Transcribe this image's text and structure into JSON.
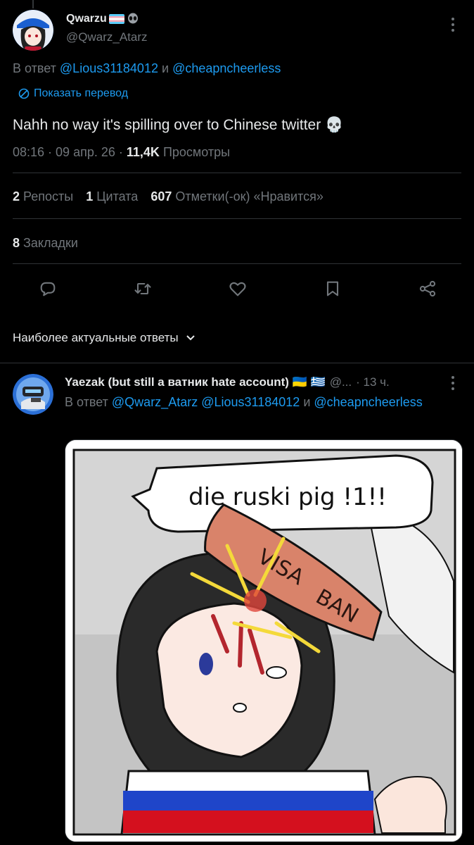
{
  "tweet": {
    "display_name": "Qwarzu",
    "handle": "@Qwarz_Atarz",
    "reply_prefix": "В ответ",
    "reply_mention_1": "@Lious31184012",
    "reply_and": "и",
    "reply_mention_2": "@cheapncheerless",
    "translate_label": "Показать перевод",
    "text": "Nahh no way it's spilling over to Chinese twitter 💀",
    "time": "08:16 · 09 апр. 26 ·",
    "views_count": "11,4K",
    "views_label": "Просмотры",
    "reposts_count": "2",
    "reposts_label": "Репосты",
    "quotes_count": "1",
    "quotes_label": "Цитата",
    "likes_count": "607",
    "likes_label": "Отметки(-ок) «Нравится»",
    "bookmarks_count": "8",
    "bookmarks_label": "Закладки"
  },
  "actions": [
    "reply-icon",
    "retweet-icon",
    "like-icon",
    "bookmark-icon",
    "share-icon"
  ],
  "sort": {
    "label": "Наиболее актуальные ответы"
  },
  "reply": {
    "display_name": "Yaezak (but still a ватник hate account) 🇺🇦 🇬🇷",
    "handle_short": "@...",
    "time": "· 13 ч.",
    "reply_prefix": "В ответ",
    "mention_1": "@Qwarz_Atarz",
    "mention_2": "@Lious31184012",
    "reply_and": "и",
    "mention_3": "@cheapncheerless"
  },
  "media": {
    "speech_text": "die ruski pig !1!!",
    "club_text_1": "VISA",
    "club_text_2": "BAN"
  },
  "colors": {
    "accent": "#1d9bf0",
    "muted": "#71767b",
    "text": "#e7e9ea",
    "divider": "#2f3336"
  }
}
